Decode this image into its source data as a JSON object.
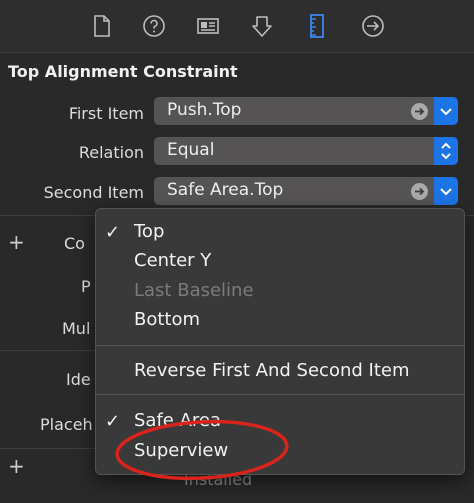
{
  "constraint": {
    "title": "Top Alignment Constraint",
    "first_item": {
      "label": "First Item",
      "value": "Push.Top"
    },
    "relation": {
      "label": "Relation",
      "value": "Equal"
    },
    "second_item": {
      "label": "Second Item",
      "value": "Safe Area.Top"
    }
  },
  "background_labels": {
    "con": "Co",
    "p": "P",
    "mul": "Mul",
    "ide": "Ide",
    "placeh": "Placeh",
    "instal": "Installed"
  },
  "menu": {
    "items": [
      {
        "label": "Top",
        "checked": true,
        "enabled": true
      },
      {
        "label": "Center Y",
        "checked": false,
        "enabled": true
      },
      {
        "label": "Last Baseline",
        "checked": false,
        "enabled": false
      },
      {
        "label": "Bottom",
        "checked": false,
        "enabled": true
      },
      {
        "label": "Reverse First And Second Item",
        "checked": false,
        "enabled": true
      },
      {
        "label": "Safe Area",
        "checked": true,
        "enabled": true
      },
      {
        "label": "Superview",
        "checked": false,
        "enabled": true
      }
    ],
    "check_glyph": "✓"
  },
  "plus_glyph": "+",
  "colors": {
    "accent": "#1d74e6",
    "annotation": "#d8241c",
    "selected_tab": "#3a86f0"
  },
  "icons": [
    "file-icon",
    "help-icon",
    "identity-icon",
    "attributes-icon",
    "size-ruler-icon",
    "connections-icon"
  ]
}
